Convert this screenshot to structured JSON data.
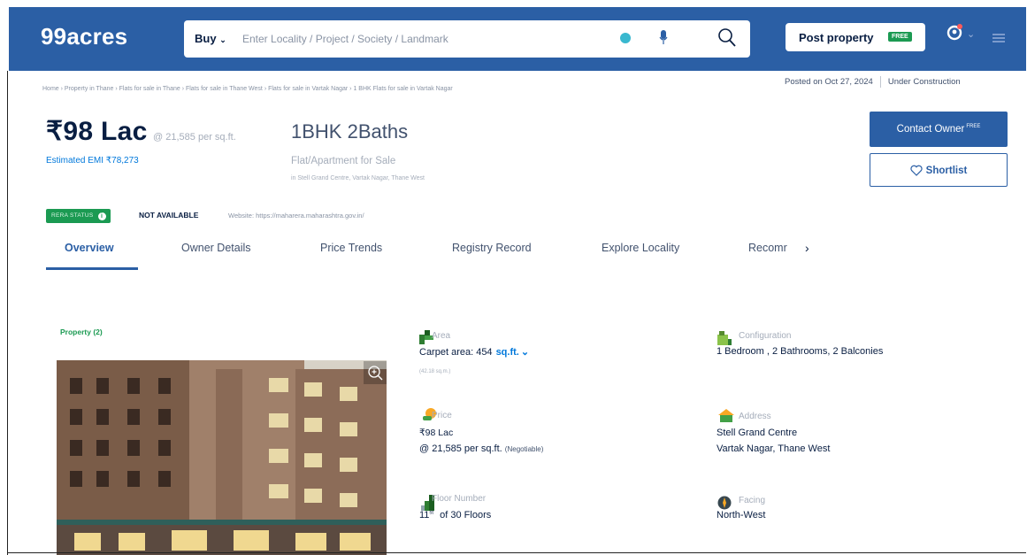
{
  "header": {
    "logo": "99acres",
    "buy_label": "Buy",
    "search_placeholder": "Enter Locality / Project / Society / Landmark",
    "post_property_label": "Post property",
    "free_tag": "FREE"
  },
  "breadcrumb": "Home › Property in Thane › Flats for sale in Thane › Flats for sale in Thane West › Flats for sale in Vartak Nagar › 1 BHK Flats for sale in Vartak Nagar",
  "posted": {
    "date": "Posted on Oct 27, 2024",
    "status": "Under Construction"
  },
  "listing": {
    "price": "₹98 Lac",
    "price_per_sqft": "@ 21,585 per sq.ft.",
    "emi": "Estimated EMI ₹78,273",
    "title": "1BHK 2Baths",
    "type": "Flat/Apartment for Sale",
    "address": "in Stell Grand Centre, Vartak Nagar, Thane West",
    "rera_label": "RERA STATUS",
    "rera_status": "NOT AVAILABLE",
    "website": "Website: https://maharera.maharashtra.gov.in/"
  },
  "actions": {
    "contact_owner": "Contact Owner",
    "contact_free": "FREE",
    "shortlist": "Shortlist"
  },
  "tabs": [
    {
      "label": "Overview"
    },
    {
      "label": "Owner Details"
    },
    {
      "label": "Price Trends"
    },
    {
      "label": "Registry Record"
    },
    {
      "label": "Explore Locality"
    },
    {
      "label": "Recomr"
    }
  ],
  "overview": {
    "property_label": "Property (2)",
    "area": {
      "label": "Area",
      "value": "Carpet area: 454",
      "unit": "sq.ft.",
      "sub": "(42.18 sq.m.)"
    },
    "configuration": {
      "label": "Configuration",
      "value": "1 Bedroom , 2 Bathrooms, 2 Balconies"
    },
    "price": {
      "label": "Price",
      "value": "₹98 Lac",
      "rate": "@ 21,585 per sq.ft.",
      "negotiable": "(Negotiable)"
    },
    "address": {
      "label": "Address",
      "line1": "Stell Grand Centre",
      "line2": "Vartak Nagar, Thane West"
    },
    "floor": {
      "label": "Floor Number",
      "floor": "11",
      "suffix": "st",
      "total": "of 30 Floors"
    },
    "facing": {
      "label": "Facing",
      "value": "North-West"
    }
  },
  "colors": {
    "brand_blue": "#2b5fa5",
    "rera_green": "#1b9a52",
    "link_blue": "#0078db"
  }
}
